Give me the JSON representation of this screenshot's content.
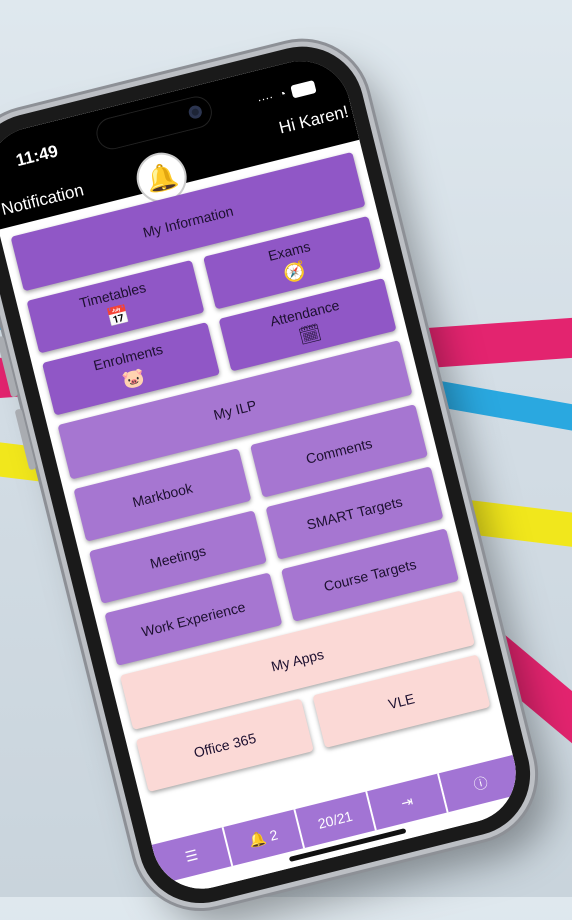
{
  "status": {
    "time": "11:49"
  },
  "header": {
    "greeting": "Hi Karen!",
    "notification_label": "Notification",
    "bell_icon": "bell-icon"
  },
  "tiles": {
    "my_information": "My Information",
    "timetables": "Timetables",
    "exams": "Exams",
    "enrolments": "Enrolments",
    "attendance": "Attendance",
    "my_ilp": "My ILP",
    "markbook": "Markbook",
    "comments": "Comments",
    "meetings": "Meetings",
    "smart_targets": "SMART Targets",
    "work_experience": "Work Experience",
    "course_targets": "Course Targets",
    "my_apps": "My Apps",
    "office365": "Office 365",
    "vle": "VLE"
  },
  "bottom_bar": {
    "notification_count": "2",
    "academic_year": "20/21"
  },
  "colors": {
    "dark_purple": "#9057c6",
    "light_purple": "#a676d1",
    "pink": "#fbd9d6",
    "bar": "#a274d4"
  }
}
